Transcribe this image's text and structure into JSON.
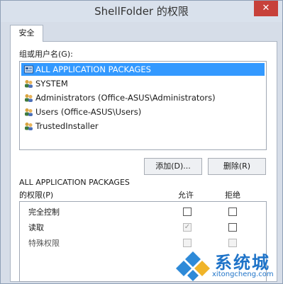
{
  "window": {
    "title": "ShellFolder 的权限",
    "close_glyph": "✕"
  },
  "tabs": [
    {
      "label": "安全"
    }
  ],
  "group_label": "组或用户名(G):",
  "users": [
    {
      "name": "ALL APPLICATION PACKAGES",
      "icon": "package-icon",
      "selected": true
    },
    {
      "name": "SYSTEM",
      "icon": "users-icon"
    },
    {
      "name": "Administrators (Office-ASUS\\Administrators)",
      "icon": "users-icon"
    },
    {
      "name": "Users (Office-ASUS\\Users)",
      "icon": "users-icon"
    },
    {
      "name": "TrustedInstaller",
      "icon": "users-icon"
    }
  ],
  "buttons": {
    "add": "添加(D)...",
    "remove": "删除(R)"
  },
  "permissions": {
    "heading_line1": "ALL APPLICATION PACKAGES",
    "heading_line2": "的权限(P)",
    "allow": "允许",
    "deny": "拒绝",
    "rows": [
      {
        "label": "完全控制",
        "allow": false,
        "deny": false,
        "disabled": false
      },
      {
        "label": "读取",
        "allow": true,
        "deny": false,
        "disabled": false,
        "allow_disabled": true
      },
      {
        "label": "特殊权限",
        "allow": false,
        "deny": false,
        "disabled": true
      }
    ]
  },
  "watermark": {
    "text": "系统城",
    "url": "xitongcheng.com"
  },
  "colors": {
    "selection": "#3399ff",
    "watermark": "#1e73c8"
  }
}
